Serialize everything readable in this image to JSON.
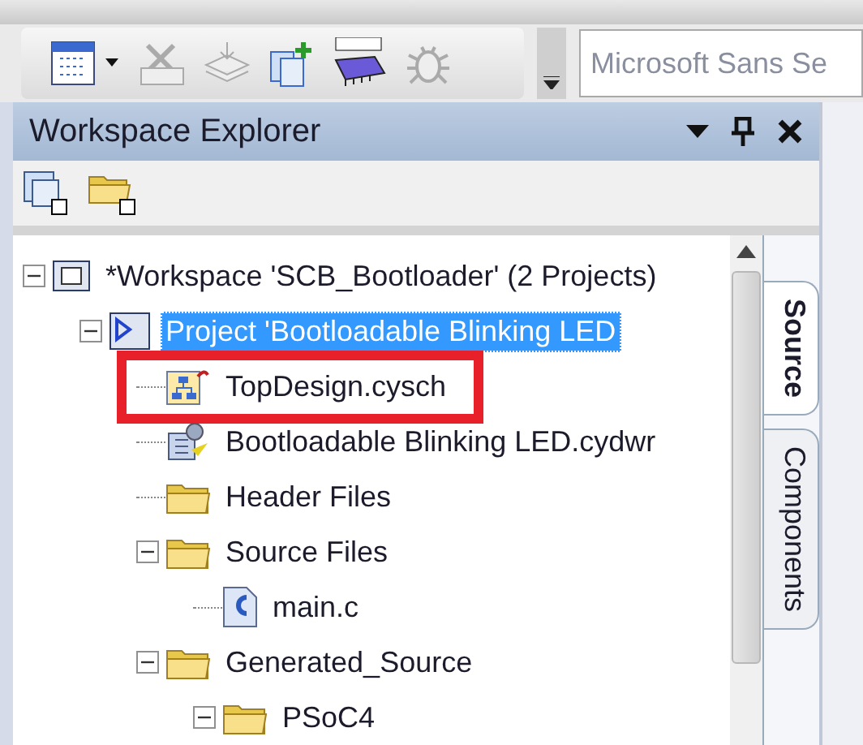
{
  "toolbar": {
    "font_box": {
      "value": "Microsoft Sans Se"
    }
  },
  "panel": {
    "title": "Workspace Explorer"
  },
  "tree": [
    {
      "label": "*Workspace 'SCB_Bootloader' (2 Projects)",
      "kind": "workspace",
      "selected": false,
      "expanded": true,
      "children": [
        {
          "label": "Project 'Bootloadable Blinking LED",
          "kind": "project",
          "selected": true,
          "expanded": true,
          "children": [
            {
              "label": "TopDesign.cysch",
              "kind": "schematic",
              "selected": false,
              "highlighted": true
            },
            {
              "label": "Bootloadable Blinking LED.cydwr",
              "kind": "resources",
              "selected": false
            },
            {
              "label": "Header Files",
              "kind": "folder",
              "selected": false
            },
            {
              "label": "Source Files",
              "kind": "folder",
              "selected": false,
              "expanded": true,
              "children": [
                {
                  "label": "main.c",
                  "kind": "cfile",
                  "selected": false
                }
              ]
            },
            {
              "label": "Generated_Source",
              "kind": "folder",
              "selected": false,
              "expanded": true,
              "children": [
                {
                  "label": "PSoC4",
                  "kind": "folder",
                  "selected": false,
                  "expanded": true
                }
              ]
            }
          ]
        }
      ]
    }
  ],
  "side_tabs": [
    {
      "label": "Source",
      "selected": true
    },
    {
      "label": "Components",
      "selected": false
    }
  ]
}
